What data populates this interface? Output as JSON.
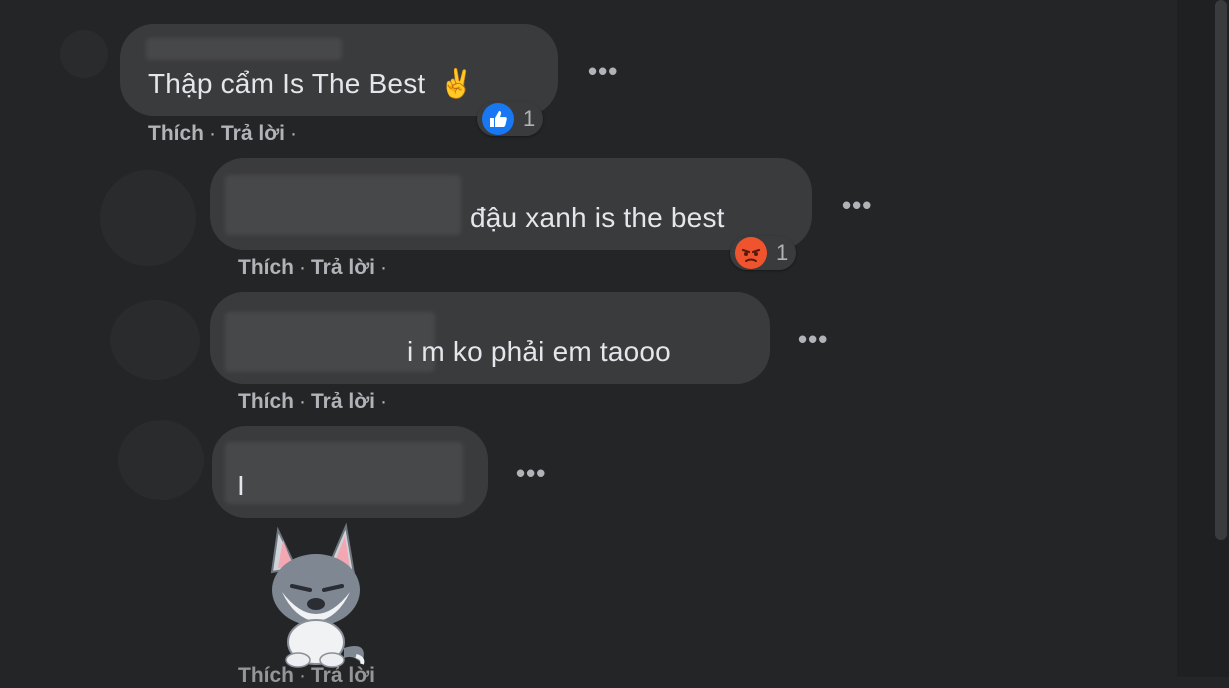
{
  "comments": [
    {
      "text": "Thập cẩm Is The Best",
      "emoji": "✌",
      "reaction": {
        "icon": "like-icon",
        "count": "1",
        "color": "#1877f2"
      }
    },
    {
      "text": "đậu xanh is the best",
      "reaction": {
        "icon": "angry-icon",
        "count": "1",
        "color": "#f0542f"
      }
    },
    {
      "text": "i m ko phải em taooo"
    },
    {
      "text": "I",
      "sticker": "wolf-sticker"
    }
  ],
  "actions": {
    "like": "Thích",
    "reply": "Trả lời",
    "separator": "·"
  },
  "more_icon": "•••"
}
